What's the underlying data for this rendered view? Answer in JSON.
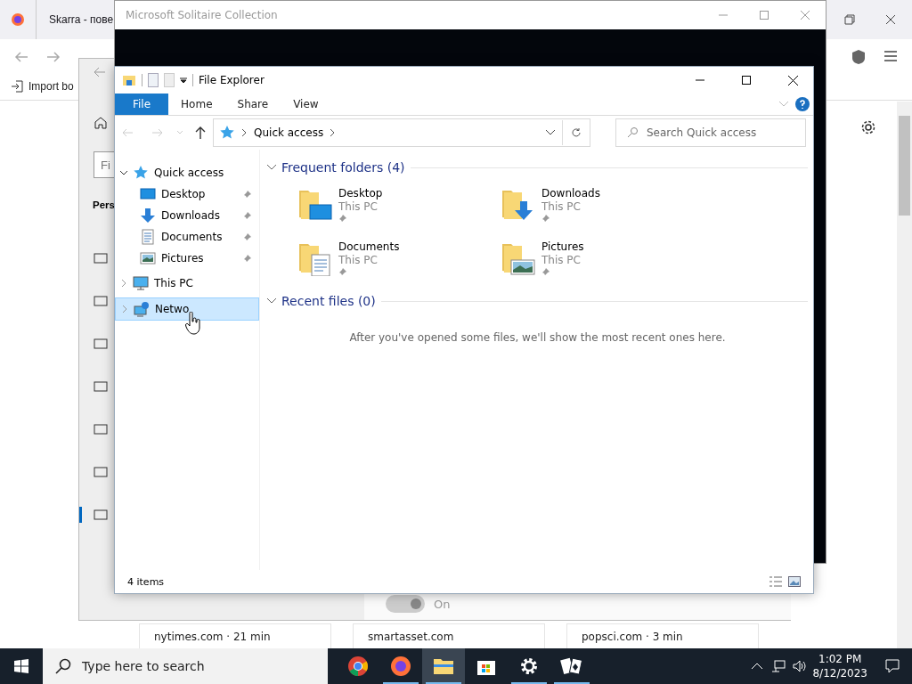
{
  "browser": {
    "tab_title": "Skarra - пове",
    "bookmark": "Import bo",
    "feed_cards": [
      "nytimes.com · 21 min",
      "smartasset.com",
      "popsci.com · 3 min"
    ]
  },
  "settings_window": {
    "search_text": "Fi",
    "heading": "Pers",
    "nav_icons": [
      {
        "selected": false
      },
      {
        "selected": false
      },
      {
        "selected": false
      },
      {
        "selected": false
      },
      {
        "selected": false
      },
      {
        "selected": false
      },
      {
        "selected": true
      }
    ],
    "toggle": {
      "on": true,
      "label": "On"
    }
  },
  "solitaire_window": {
    "title": "Microsoft Solitaire Collection"
  },
  "explorer": {
    "title": "File Explorer",
    "ribbon_tabs": [
      {
        "label": "File",
        "selected": true
      },
      {
        "label": "Home",
        "selected": false
      },
      {
        "label": "Share",
        "selected": false
      },
      {
        "label": "View",
        "selected": false
      }
    ],
    "address": "Quick access",
    "search_placeholder": "Search Quick access",
    "nav_tree": [
      {
        "label": "Quick access",
        "kind": "star",
        "expanded": true,
        "selected": false,
        "children": [
          {
            "label": "Desktop",
            "kind": "desktop",
            "pinned": true,
            "selected": false
          },
          {
            "label": "Downloads",
            "kind": "downloads",
            "pinned": true,
            "selected": false
          },
          {
            "label": "Documents",
            "kind": "documents",
            "pinned": true,
            "selected": false
          },
          {
            "label": "Pictures",
            "kind": "pictures",
            "pinned": true,
            "selected": false
          }
        ]
      },
      {
        "label": "This PC",
        "kind": "pc",
        "expanded": false,
        "selected": false
      },
      {
        "label": "Netwo",
        "kind": "network",
        "expanded": false,
        "selected": true
      }
    ],
    "sections": [
      {
        "title": "Frequent folders (4)",
        "items": [
          {
            "name": "Desktop",
            "location": "This PC",
            "kind": "desktop"
          },
          {
            "name": "Downloads",
            "location": "This PC",
            "kind": "downloads"
          },
          {
            "name": "Documents",
            "location": "This PC",
            "kind": "documents"
          },
          {
            "name": "Pictures",
            "location": "This PC",
            "kind": "pictures"
          }
        ]
      },
      {
        "title": "Recent files (0)",
        "empty_message": "After you've opened some files, we'll show the most recent ones here."
      }
    ],
    "status": "4 items"
  },
  "taskbar": {
    "search_placeholder": "Type here to search",
    "apps": [
      {
        "kind": "chrome",
        "selected": false,
        "running": false
      },
      {
        "kind": "firefox",
        "selected": false,
        "running": true
      },
      {
        "kind": "explorer",
        "selected": true,
        "running": true
      },
      {
        "kind": "store",
        "selected": false,
        "running": false
      },
      {
        "kind": "settings",
        "selected": false,
        "running": true
      },
      {
        "kind": "solitaire",
        "selected": false,
        "running": true
      }
    ],
    "time": "1:02 PM",
    "date": "8/12/2023"
  }
}
